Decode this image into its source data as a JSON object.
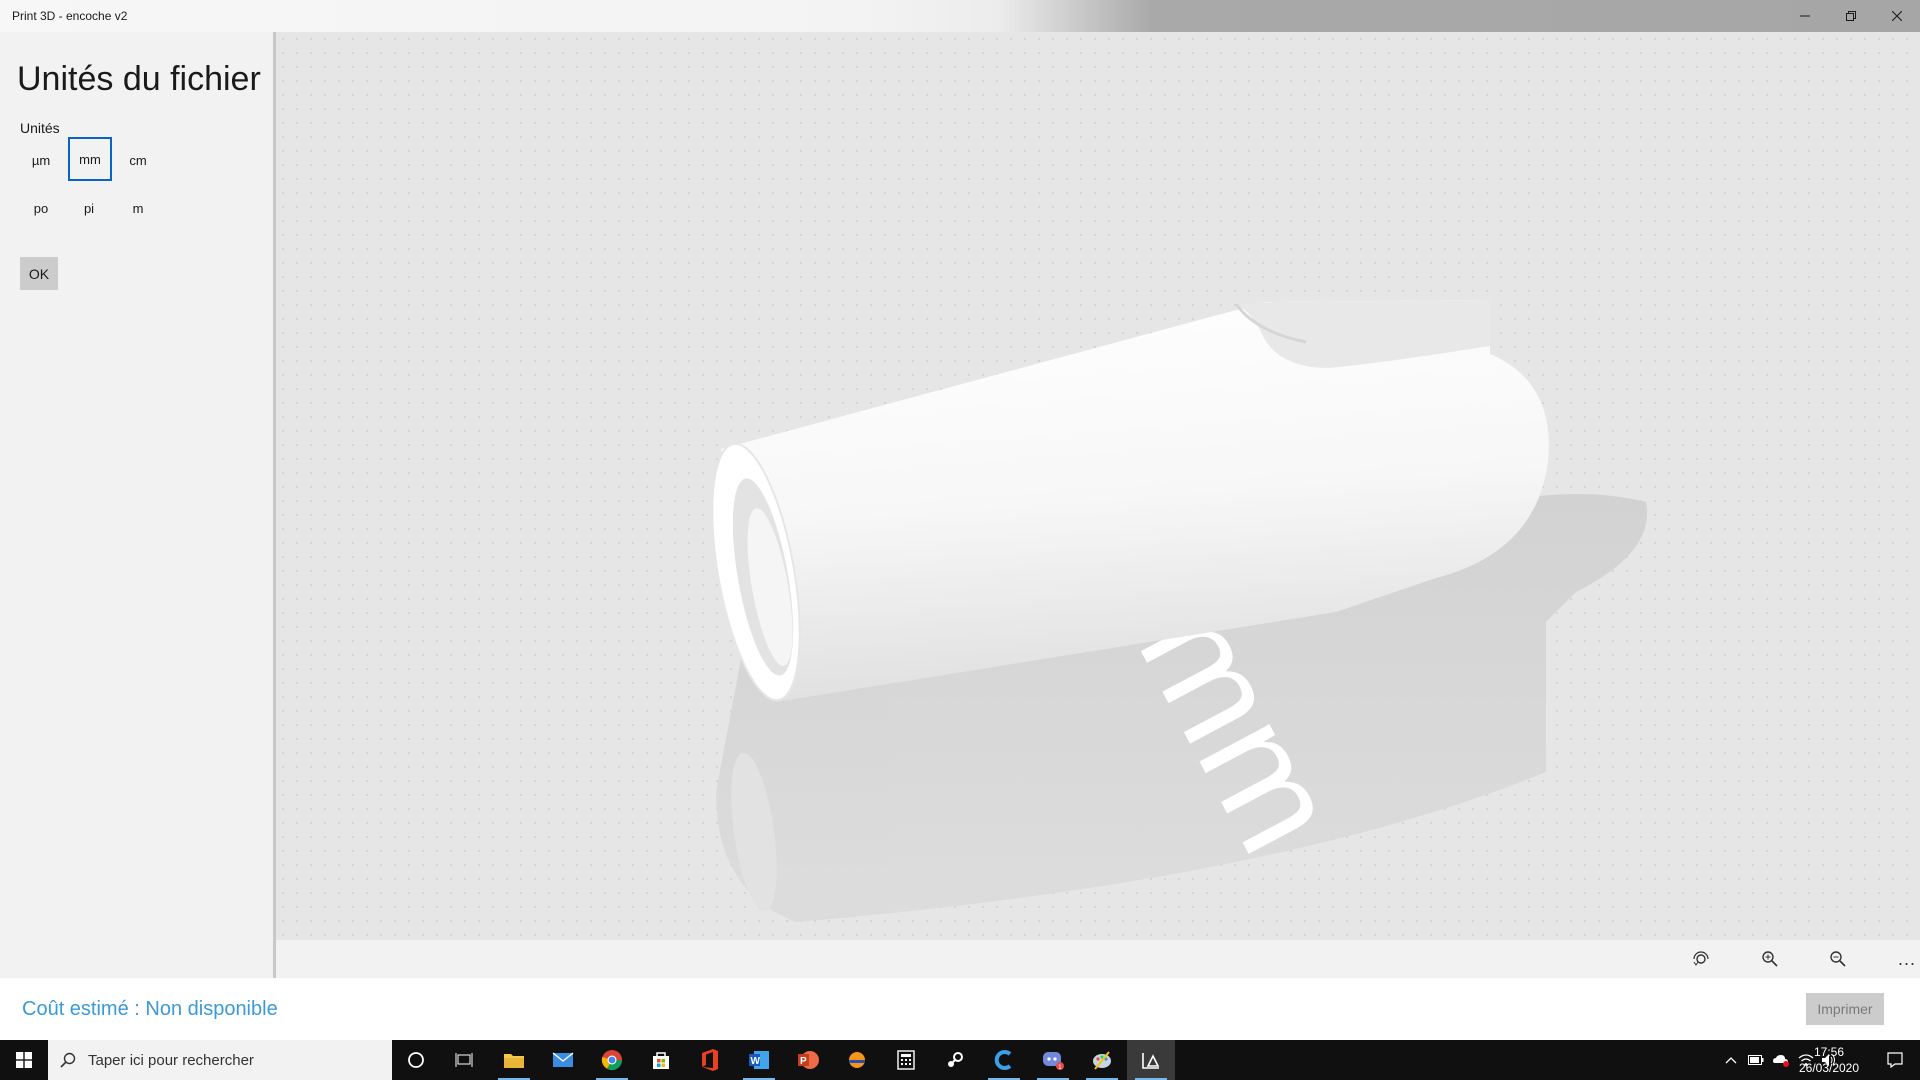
{
  "window": {
    "title": "Print 3D - encoche v2",
    "minimize": "—",
    "restore": "❐",
    "close": "✕"
  },
  "panel": {
    "title": "Unités du fichier",
    "units_label": "Unités",
    "units": [
      {
        "label": "µm",
        "selected": false
      },
      {
        "label": "mm",
        "selected": true
      },
      {
        "label": "cm",
        "selected": false
      },
      {
        "label": "po",
        "selected": false
      },
      {
        "label": "pi",
        "selected": false
      },
      {
        "label": "m",
        "selected": false
      }
    ],
    "ok_label": "OK"
  },
  "viewport": {
    "model_unit_label": "mm"
  },
  "toolbar": {
    "more_label": "..."
  },
  "costbar": {
    "cost_text": "Coût estimé : Non disponible",
    "print_label": "Imprimer"
  },
  "taskbar": {
    "search_placeholder": "Taper ici pour rechercher",
    "time": "17:56",
    "date": "26/03/2020"
  },
  "colors": {
    "accent": "#0a64c8",
    "cost_text": "#3b9ad9",
    "taskbar": "#101010"
  }
}
